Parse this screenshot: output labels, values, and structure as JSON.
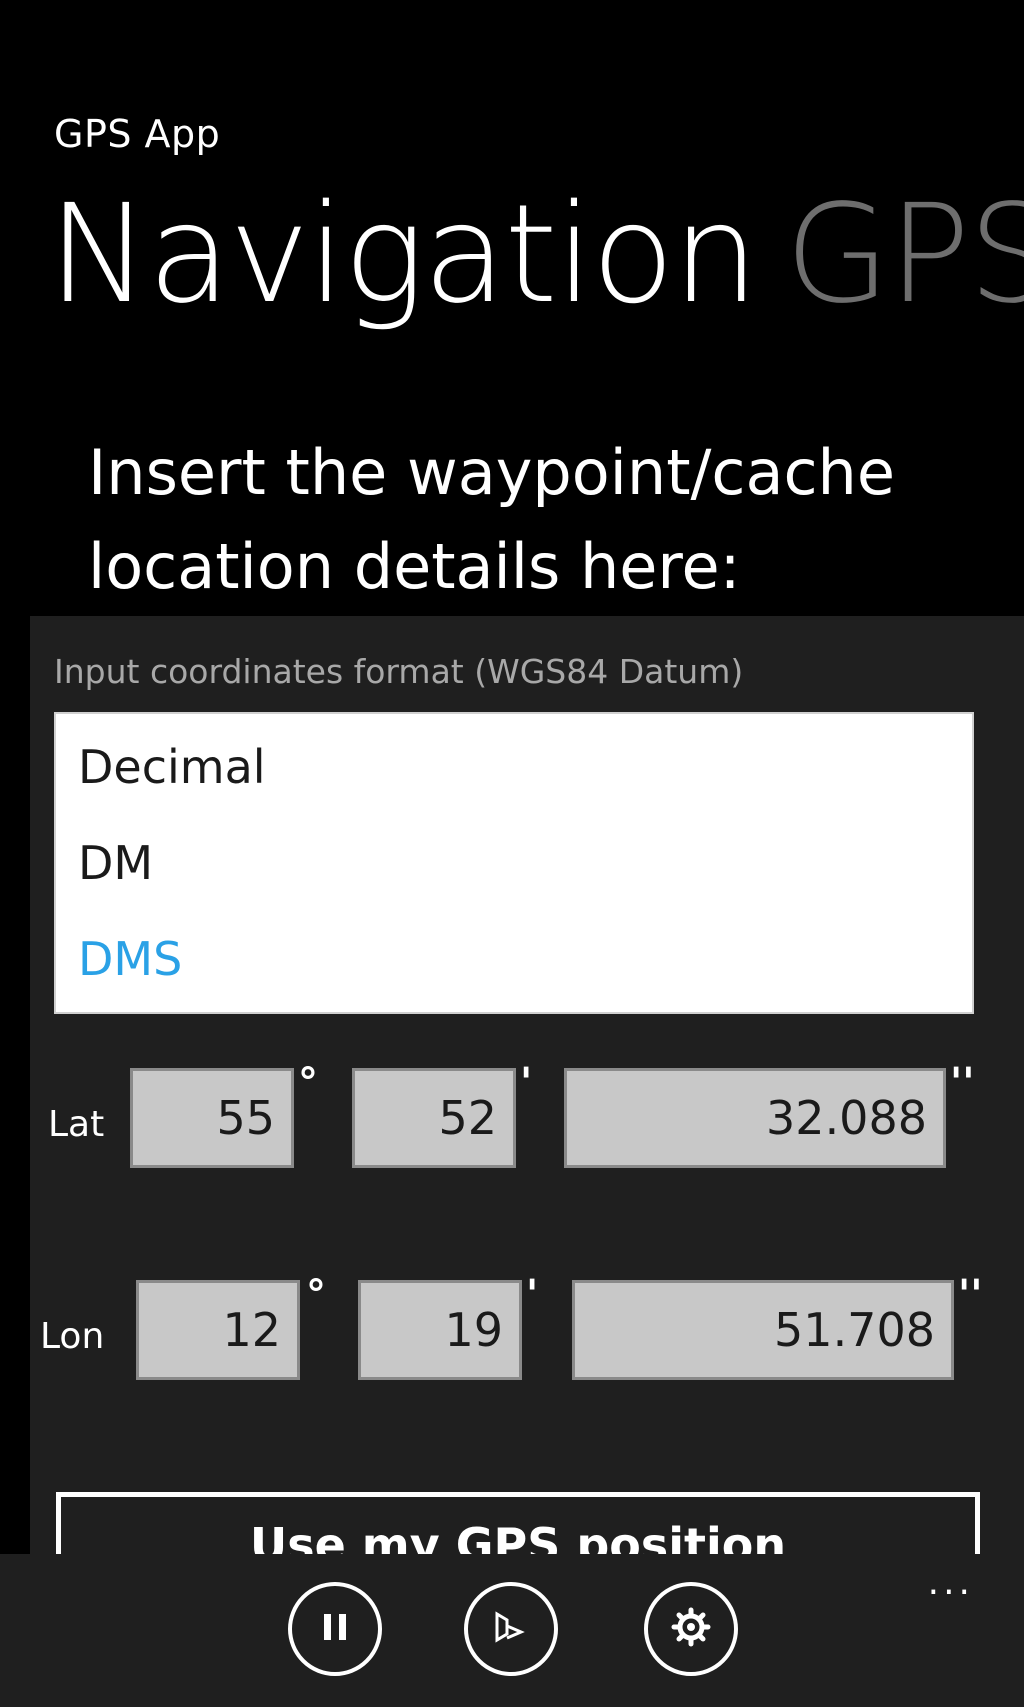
{
  "app": {
    "title": "GPS App"
  },
  "pivot": {
    "active": "Navigation",
    "next": "GPS"
  },
  "instructions": {
    "line1": "Insert the waypoint/cache",
    "line2": "location details here:"
  },
  "format": {
    "label": "Input coordinates format (WGS84 Datum)",
    "options": [
      "Decimal",
      "DM",
      "DMS"
    ],
    "selected": "DMS"
  },
  "latitude": {
    "label": "Lat",
    "degrees": "55",
    "minutes": "52",
    "seconds": "32.088"
  },
  "longitude": {
    "label": "Lon",
    "degrees": "12",
    "minutes": "19",
    "seconds": "51.708"
  },
  "units": {
    "degree": "°",
    "minute": "'",
    "second": "''"
  },
  "actions": {
    "gps_button": "Use my GPS position"
  },
  "app_bar": {
    "ellipsis": "...",
    "icons": [
      "pause-icon",
      "bing-icon",
      "settings-icon"
    ]
  },
  "colors": {
    "accent": "#2aa1e6",
    "background": "#000000",
    "panel": "#1f1f1f",
    "input": "#c8c8c8"
  }
}
